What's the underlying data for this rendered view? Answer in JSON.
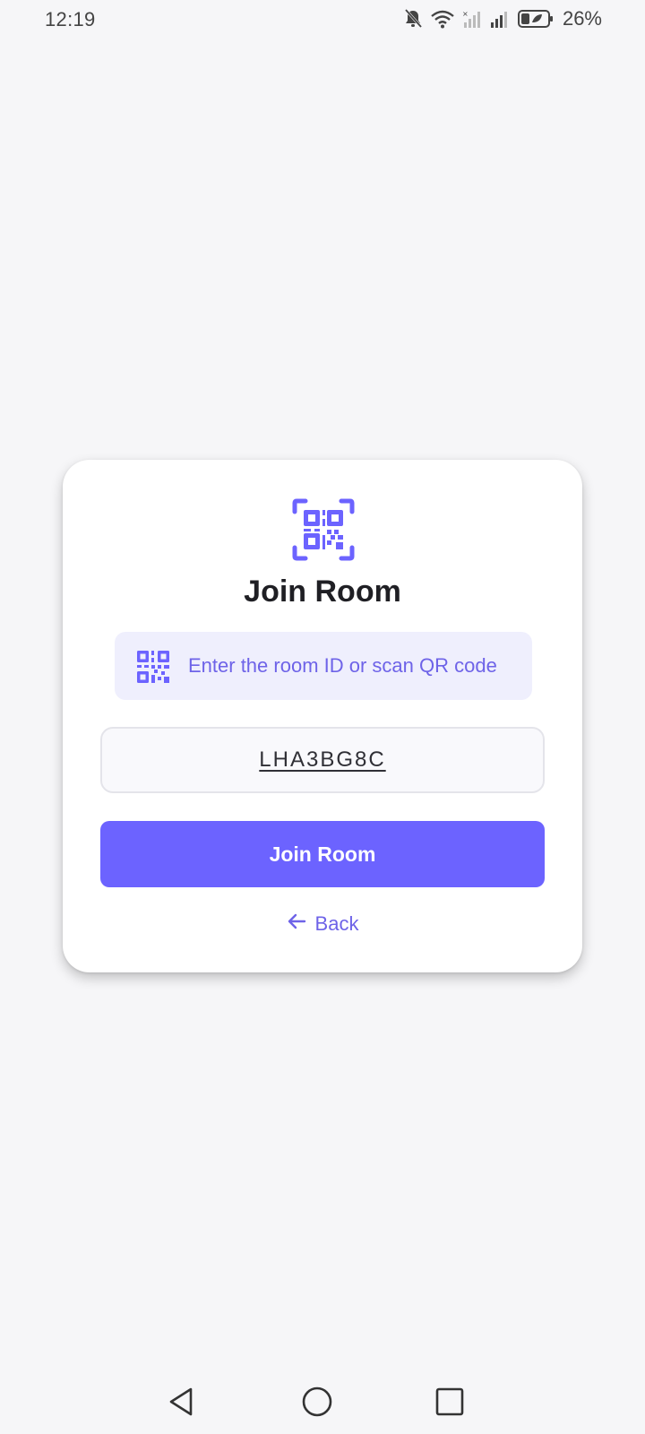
{
  "status_bar": {
    "time": "12:19",
    "battery": "26%",
    "icons": [
      "mute-bell-icon",
      "wifi-icon",
      "signal-icon",
      "signal-icon",
      "battery-icon"
    ]
  },
  "card": {
    "icon": "qr-code-icon",
    "title": "Join Room",
    "hint": {
      "icon": "qr-code-icon",
      "text": "Enter the room ID or scan QR code"
    },
    "room_input": {
      "value": "LHA3BG8C"
    },
    "join_button_label": "Join Room",
    "back": {
      "icon": "arrow-left-icon",
      "label": "Back"
    }
  },
  "nav_bar": {
    "buttons": [
      "back-triangle-icon",
      "home-circle-icon",
      "recents-square-icon"
    ]
  },
  "colors": {
    "background": "#f6f6f8",
    "accent": "#6c63ff",
    "accent_text": "#6e63e8",
    "hint_background": "#efeffd",
    "card_background": "#ffffff"
  }
}
